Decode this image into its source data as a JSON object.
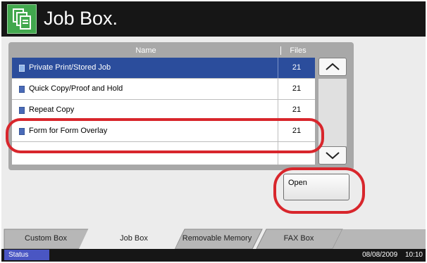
{
  "header": {
    "title": "Job Box."
  },
  "list": {
    "columns": {
      "name": "Name",
      "files": "Files"
    },
    "rows": [
      {
        "name": "Private Print/Stored Job",
        "files": "21",
        "selected": true
      },
      {
        "name": "Quick Copy/Proof and Hold",
        "files": "21",
        "selected": false
      },
      {
        "name": "Repeat Copy",
        "files": "21",
        "selected": false
      },
      {
        "name": "Form for Form Overlay",
        "files": "21",
        "selected": false
      }
    ]
  },
  "buttons": {
    "open": "Open"
  },
  "tabs": [
    "Custom Box",
    "Job Box",
    "Removable Memory",
    "FAX Box"
  ],
  "active_tab": "Job Box",
  "status": {
    "label": "Status",
    "date": "08/08/2009",
    "time": "10:10"
  },
  "icons": {
    "app": "job-box-icon",
    "scroll_up": "chevron-up-icon",
    "scroll_down": "chevron-down-icon",
    "row": "document-icon"
  },
  "colors": {
    "header": "#161616",
    "selected_row": "#2b4d9c",
    "highlight": "#d8262c",
    "status_button": "#4a56c3",
    "app_icon": "#42a84e"
  }
}
